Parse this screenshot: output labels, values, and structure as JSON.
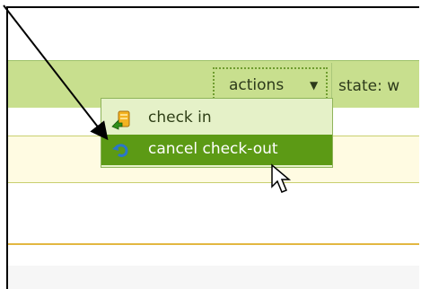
{
  "toolbar": {
    "actions_label": "actions",
    "state_label": "state: w"
  },
  "menu": {
    "items": [
      {
        "label": "check in",
        "icon": "check-in-icon"
      },
      {
        "label": "cancel check-out",
        "icon": "cancel-check-out-icon"
      }
    ]
  },
  "colors": {
    "toolbar_bg": "#c8df8e",
    "menu_bg": "#e5f1c8",
    "highlight": "#5c9a15",
    "row_bg": "#fffbe2",
    "accent_line": "#e2b741"
  },
  "icons": {
    "caret": "caret-down-icon",
    "pointer": "mouse-pointer-icon",
    "arrow": "annotation-arrow-icon"
  }
}
